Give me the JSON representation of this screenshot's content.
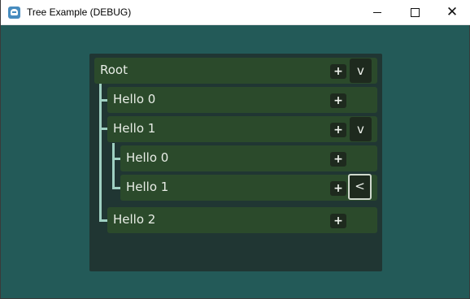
{
  "window": {
    "title": "Tree Example (DEBUG)",
    "controls": {
      "minimize": "",
      "maximize": "",
      "close": "✕"
    }
  },
  "tree": {
    "root": {
      "label": "Root",
      "add": "+",
      "toggle": "v"
    },
    "hello0": {
      "label": "Hello 0",
      "add": "+"
    },
    "hello1": {
      "label": "Hello 1",
      "add": "+",
      "toggle": "v"
    },
    "hello1_child0": {
      "label": "Hello 0",
      "add": "+"
    },
    "hello1_child1": {
      "label": "Hello 1",
      "add": "+",
      "toggle": "<"
    },
    "hello2": {
      "label": "Hello 2",
      "add": "+"
    }
  },
  "colors": {
    "background": "#235a58",
    "panel": "#203633",
    "row": "#2b4a2b",
    "button": "#1e2a1e",
    "guide": "#9fd0c2"
  }
}
